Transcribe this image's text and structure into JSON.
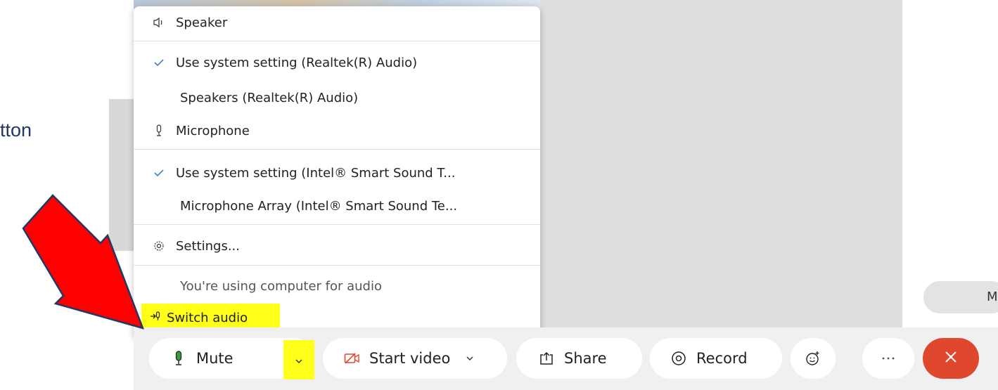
{
  "slide": {
    "partial_text": "tton"
  },
  "right_pill": {
    "text": "M"
  },
  "menu": {
    "speaker_header": "Speaker",
    "speaker_options": [
      {
        "label": "Use system setting (Realtek(R) Audio)",
        "checked": true
      },
      {
        "label": "Speakers (Realtek(R) Audio)",
        "checked": false
      }
    ],
    "microphone_header": "Microphone",
    "microphone_options": [
      {
        "label": "Use system setting (Intel® Smart Sound T...",
        "checked": true
      },
      {
        "label": "Microphone Array (Intel® Smart Sound Te...",
        "checked": false
      }
    ],
    "settings_label": "Settings...",
    "status_text": "You're using computer for audio",
    "switch_audio_label": "Switch audio"
  },
  "toolbar": {
    "mute_label": "Mute",
    "video_label": "Start video",
    "share_label": "Share",
    "record_label": "Record"
  },
  "colors": {
    "highlight": "#ffff1a",
    "end_button": "#e0482e",
    "arrow": "#ff0000",
    "check": "#3f7fbf"
  },
  "icons": [
    "speaker-icon",
    "check-icon",
    "microphone-icon",
    "gear-icon",
    "switch-audio-icon",
    "mic-mute-icon",
    "chevron-down-icon",
    "video-off-icon",
    "share-icon",
    "record-icon",
    "emoji-icon",
    "more-icon",
    "close-icon",
    "red-arrow"
  ]
}
